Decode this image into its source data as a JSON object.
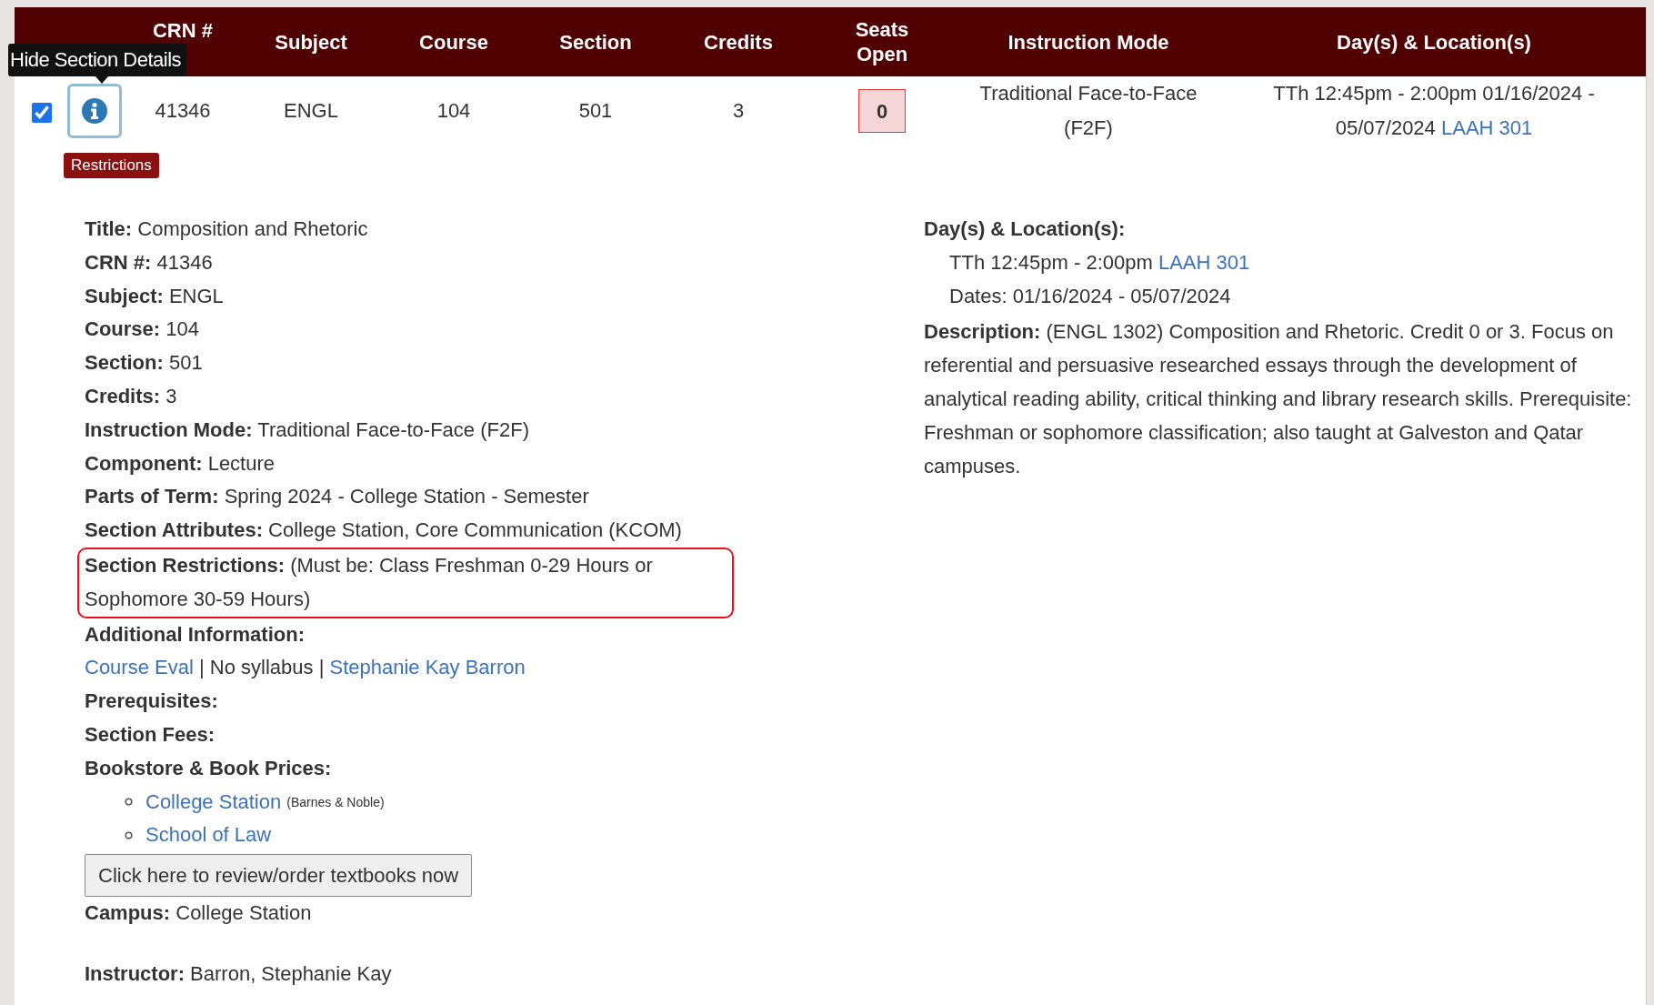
{
  "tooltip": "Hide Section Details",
  "table": {
    "columns": [
      "CRN #",
      "Subject",
      "Course",
      "Section",
      "Credits",
      "Seats Open",
      "Instruction Mode",
      "Day(s) & Location(s)"
    ],
    "rows": [
      {
        "checked": true,
        "badge": "Restrictions",
        "crn": "41346",
        "subject": "ENGL",
        "course": "104",
        "section": "501",
        "credits": "3",
        "seats_open": "0",
        "instruction_mode": "Traditional Face-to-Face (F2F)",
        "days_locations": "TTh 12:45pm - 2:00pm 01/16/2024 -\n05/07/2024",
        "location_link": "LAAH 301"
      }
    ]
  },
  "details": {
    "left": [
      {
        "kind": "field",
        "label": "Title:",
        "value": "Composition and Rhetoric"
      },
      {
        "kind": "field",
        "label": "CRN #:",
        "value": "41346"
      },
      {
        "kind": "field",
        "label": "Subject:",
        "value": "ENGL"
      },
      {
        "kind": "field",
        "label": "Course:",
        "value": "104"
      },
      {
        "kind": "field",
        "label": "Section:",
        "value": "501"
      },
      {
        "kind": "field",
        "label": "Credits:",
        "value": "3"
      },
      {
        "kind": "field",
        "label": "Instruction Mode:",
        "value": "Traditional Face-to-Face (F2F)"
      },
      {
        "kind": "field",
        "label": "Component:",
        "value": "Lecture"
      },
      {
        "kind": "field",
        "label": "Parts of Term:",
        "value": "Spring 2024 - College Station - Semester"
      },
      {
        "kind": "field",
        "label": "Section Attributes:",
        "value": "College Station, Core Communication (KCOM)"
      },
      {
        "kind": "field",
        "label": "Section Restrictions:",
        "value": "(Must be: Class Freshman 0-29 Hours or Sophomore 30-59 Hours)",
        "highlighted": true
      },
      {
        "kind": "heading",
        "label": "Additional Information:"
      },
      {
        "kind": "links",
        "separator": "|",
        "parts": [
          {
            "text": "Course Eval",
            "link": true
          },
          {
            "text": "No syllabus",
            "link": false
          },
          {
            "text": "Stephanie Kay Barron",
            "link": true
          }
        ]
      },
      {
        "kind": "heading",
        "label": "Prerequisites:"
      },
      {
        "kind": "heading",
        "label": "Section Fees:"
      },
      {
        "kind": "heading",
        "label": "Bookstore & Book Prices:"
      },
      {
        "kind": "list",
        "items": [
          {
            "text": "College Station",
            "note": "(Barnes & Noble)"
          },
          {
            "text": "School of Law"
          }
        ]
      },
      {
        "kind": "button",
        "label": "Click here to review/order textbooks now"
      },
      {
        "kind": "field",
        "label": "Campus:",
        "value": "College Station"
      },
      {
        "kind": "field",
        "label": "Instructor:",
        "value": "Barron, Stephanie Kay",
        "spaced": true
      }
    ],
    "right": {
      "schedule_label": "Day(s) & Location(s):",
      "schedule": "TTh 12:45pm - 2:00pm",
      "schedule_link": "LAAH 301",
      "dates": "Dates: 01/16/2024 - 05/07/2024",
      "description_label": "Description:",
      "description": "(ENGL 1302) Composition and Rhetoric. Credit 0 or 3. Focus on referential and persuasive researched essays through the development of analytical reading ability, critical thinking and library research skills. Prerequisite: Freshman or sophomore classification; also taught at Galveston and Qatar campuses."
    }
  }
}
